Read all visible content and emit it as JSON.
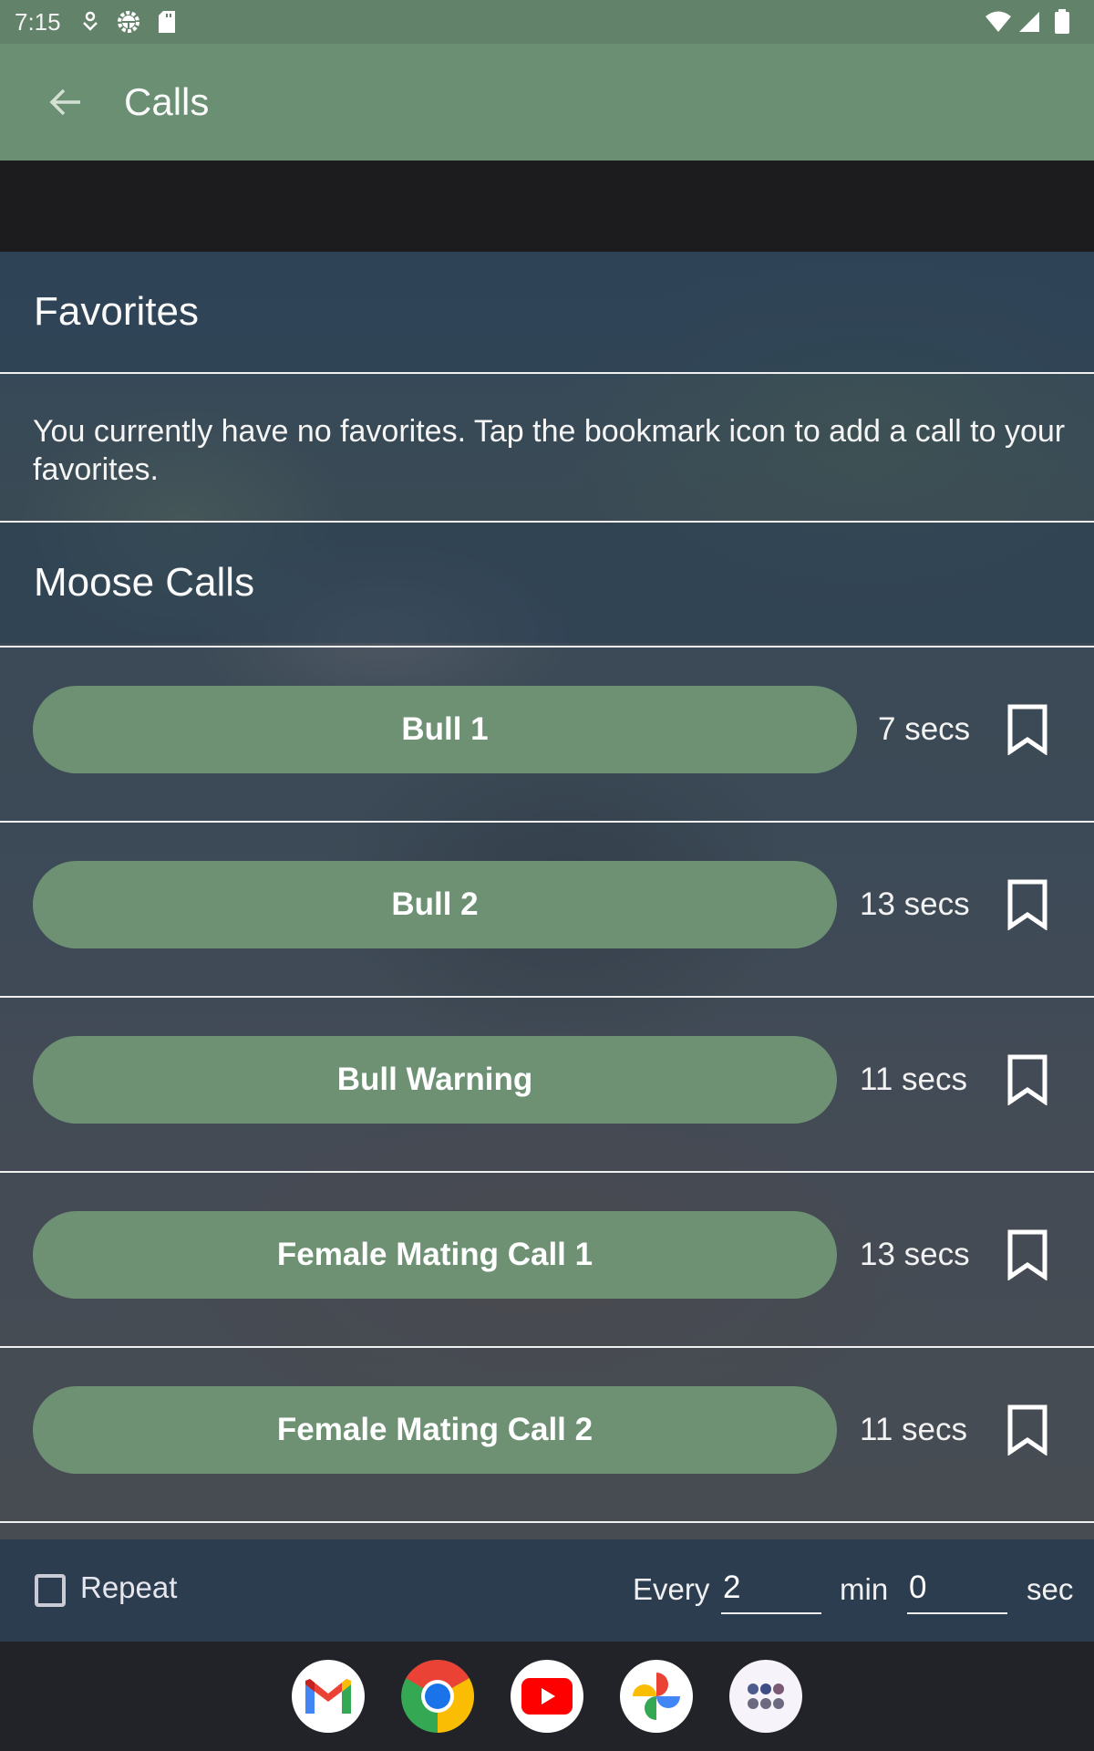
{
  "status_bar": {
    "time": "7:15",
    "left_icons": [
      "download-arrow-icon",
      "android-settings-icon",
      "sd-card-icon"
    ],
    "right_icons": [
      "wifi-icon",
      "cell-signal-icon",
      "battery-icon"
    ]
  },
  "app_bar": {
    "back_icon": "arrow-back-icon",
    "title": "Calls"
  },
  "favorites": {
    "header": "Favorites",
    "empty_message": "You currently have no favorites. Tap the bookmark icon to add a call to your favorites."
  },
  "moose_calls": {
    "header": "Moose Calls",
    "items": [
      {
        "label": "Bull 1",
        "duration": "7 secs",
        "bookmarked": false
      },
      {
        "label": "Bull 2",
        "duration": "13 secs",
        "bookmarked": false
      },
      {
        "label": "Bull Warning",
        "duration": "11 secs",
        "bookmarked": false
      },
      {
        "label": "Female Mating Call 1",
        "duration": "13 secs",
        "bookmarked": false
      },
      {
        "label": "Female Mating Call 2",
        "duration": "11 secs",
        "bookmarked": false
      }
    ]
  },
  "repeat_bar": {
    "repeat_label": "Repeat",
    "repeat_checked": false,
    "every_label": "Every",
    "minutes_value": "2",
    "min_label": "min",
    "seconds_value": "0",
    "sec_label": "sec"
  },
  "dock": {
    "apps": [
      {
        "name": "Gmail",
        "icon": "gmail-icon"
      },
      {
        "name": "Chrome",
        "icon": "chrome-icon"
      },
      {
        "name": "YouTube",
        "icon": "youtube-icon"
      },
      {
        "name": "Photos",
        "icon": "photos-icon"
      },
      {
        "name": "App drawer",
        "icon": "app-drawer-icon"
      }
    ]
  },
  "colors": {
    "app_bar": "#6b8f72",
    "status_bar": "#62826a",
    "call_button": "#6e9174",
    "bottom_bar": "#2d3d50"
  }
}
